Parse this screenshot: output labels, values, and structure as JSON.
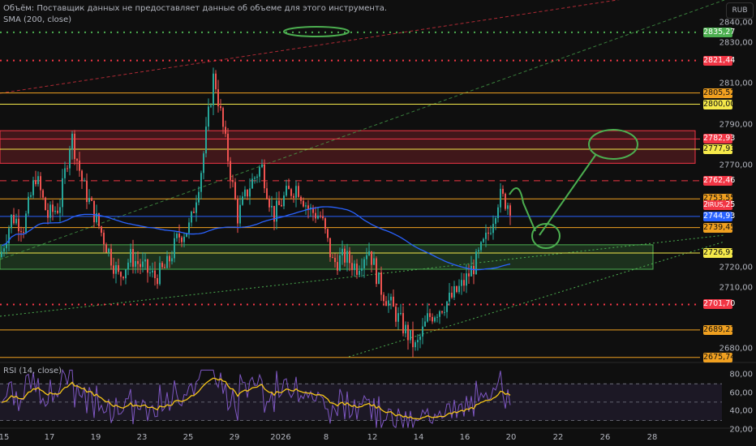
{
  "legend": {
    "volume": "Объём: Поставщик данных не предоставляет данные об объеме для этого инструмента.",
    "sma": "SMA (200, close)"
  },
  "currency_button": "RUB",
  "symbol_tag": "IRUS",
  "price_axis": [
    "2840,00",
    "2830,00",
    "2810,00",
    "2790,00",
    "2770,00",
    "2720,00",
    "2710,00",
    "2680,00"
  ],
  "price_tags": [
    {
      "label": "2835,27",
      "price": 2835.27,
      "color": "#4caf50",
      "line": "dotted"
    },
    {
      "label": "2821,44",
      "price": 2821.44,
      "color": "#f23645",
      "line": "dotted"
    },
    {
      "label": "2805,52",
      "price": 2805.52,
      "color": "#f0a020",
      "line": "solid"
    },
    {
      "label": "2800,00",
      "price": 2800.0,
      "color": "#f5e94a",
      "line": "solid"
    },
    {
      "label": "2782,93",
      "price": 2782.93,
      "color": "#f23645",
      "line": "solid"
    },
    {
      "label": "2777,93",
      "price": 2777.93,
      "color": "#f5e94a",
      "line": "solid"
    },
    {
      "label": "2762,46",
      "price": 2762.46,
      "color": "#f23645",
      "line": "dashed"
    },
    {
      "label": "2753,55",
      "price": 2753.55,
      "color": "#f0a020",
      "line": "solid"
    },
    {
      "label": "2750,25",
      "price": 2750.25,
      "color": "#f23645",
      "line": "none"
    },
    {
      "label": "2744,93",
      "price": 2744.93,
      "color": "#2962ff",
      "line": "solid"
    },
    {
      "label": "2739,45",
      "price": 2739.45,
      "color": "#f0a020",
      "line": "solid"
    },
    {
      "label": "2726,97",
      "price": 2726.97,
      "color": "#f5e94a",
      "line": "solid"
    },
    {
      "label": "2701,70",
      "price": 2701.7,
      "color": "#f23645",
      "line": "dotted"
    },
    {
      "label": "2689,21",
      "price": 2689.21,
      "color": "#f0a020",
      "line": "solid"
    },
    {
      "label": "2675,74",
      "price": 2675.74,
      "color": "#f0a020",
      "line": "solid"
    }
  ],
  "time_axis": [
    "15",
    "17",
    "19",
    "23",
    "25",
    "29",
    "2026",
    "8",
    "12",
    "14",
    "16",
    "20",
    "22",
    "26",
    "28"
  ],
  "rsi": {
    "legend": "RSI (14, close)",
    "axis": [
      "80,00",
      "60,00",
      "40,00",
      "20,00"
    ]
  },
  "price_path": [
    2725,
    2745,
    2740,
    2765,
    2745,
    2750,
    2785,
    2760,
    2745,
    2730,
    2715,
    2725,
    2720,
    2715,
    2720,
    2735,
    2740,
    2770,
    2815,
    2780,
    2745,
    2760,
    2770,
    2745,
    2755,
    2760,
    2748,
    2745,
    2722,
    2725,
    2720,
    2730,
    2710,
    2700,
    2690,
    2680,
    2695,
    2700,
    2705,
    2712,
    2722,
    2735,
    2755,
    2750
  ]
}
